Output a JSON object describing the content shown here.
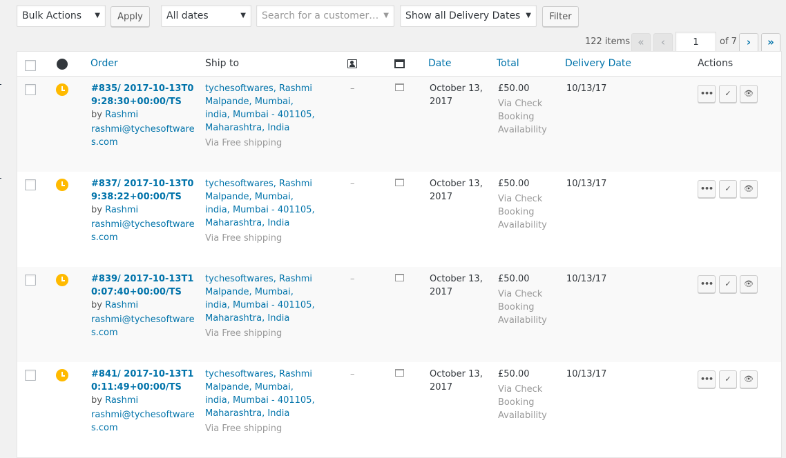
{
  "toolbar": {
    "bulk_actions": "Bulk Actions",
    "apply_label": "Apply",
    "dates_filter": "All dates",
    "customer_search_placeholder": "Search for a customer…",
    "delivery_filter": "Show all Delivery Dates",
    "filter_label": "Filter"
  },
  "pagination": {
    "items_count": "122 items",
    "first": "«",
    "prev": "‹",
    "current_page": "1",
    "of_label": "of 7",
    "next": "›",
    "last": "»"
  },
  "table": {
    "columns": {
      "order": "Order",
      "ship_to": "Ship to",
      "date": "Date",
      "total": "Total",
      "delivery_date": "Delivery Date",
      "actions": "Actions"
    },
    "rows": [
      {
        "order_link": "#835/ 2017-10-13T09:28:30+00:00/TS",
        "by": "by",
        "customer": "Rashmi",
        "email": "rashmi@tychesoftwares.com",
        "ship_address": "tychesoftwares, Rashmi Malpande, Mumbai, india, Mumbai - 401105, Maharashtra, India",
        "ship_via": "Via Free shipping",
        "billing": "–",
        "date": "October 13, 2017",
        "total": "£50.00",
        "payment": "Via Check Booking Availability",
        "delivery_date": "10/13/17"
      },
      {
        "order_link": "#837/ 2017-10-13T09:38:22+00:00/TS",
        "by": "by",
        "customer": "Rashmi",
        "email": "rashmi@tychesoftwares.com",
        "ship_address": "tychesoftwares, Rashmi Malpande, Mumbai, india, Mumbai - 401105, Maharashtra, India",
        "ship_via": "Via Free shipping",
        "billing": "–",
        "date": "October 13, 2017",
        "total": "£50.00",
        "payment": "Via Check Booking Availability",
        "delivery_date": "10/13/17"
      },
      {
        "order_link": "#839/ 2017-10-13T10:07:40+00:00/TS",
        "by": "by",
        "customer": "Rashmi",
        "email": "rashmi@tychesoftwares.com",
        "ship_address": "tychesoftwares, Rashmi Malpande, Mumbai, india, Mumbai - 401105, Maharashtra, India",
        "ship_via": "Via Free shipping",
        "billing": "–",
        "date": "October 13, 2017",
        "total": "£50.00",
        "payment": "Via Check Booking Availability",
        "delivery_date": "10/13/17"
      },
      {
        "order_link": "#841/ 2017-10-13T10:11:49+00:00/TS",
        "by": "by",
        "customer": "Rashmi",
        "email": "rashmi@tychesoftwares.com",
        "ship_address": "tychesoftwares, Rashmi Malpande, Mumbai, india, Mumbai - 401105, Maharashtra, India",
        "ship_via": "Via Free shipping",
        "billing": "–",
        "date": "October 13, 2017",
        "total": "£50.00",
        "payment": "Via Check Booking Availability",
        "delivery_date": "10/13/17"
      }
    ],
    "action_buttons": {
      "processing": "•••",
      "complete": "✓",
      "view": "👁"
    }
  },
  "colors": {
    "link": "#0073aa",
    "status_pending": "#ffba00",
    "muted_text": "#999999"
  }
}
